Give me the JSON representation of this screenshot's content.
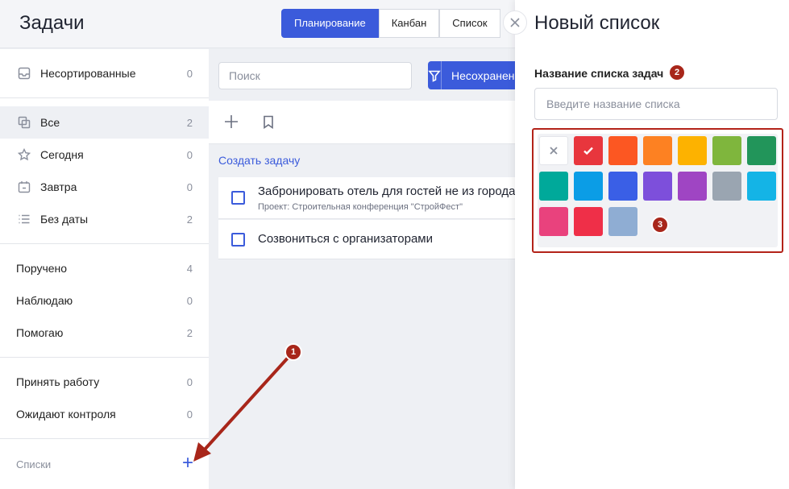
{
  "header": {
    "title": "Задачи",
    "tabs": [
      {
        "label": "Планирование",
        "active": true
      },
      {
        "label": "Канбан",
        "active": false
      },
      {
        "label": "Список",
        "active": false
      }
    ]
  },
  "sidebar": {
    "unsorted": {
      "label": "Несортированные",
      "count": "0",
      "icon": "inbox-icon"
    },
    "group1": [
      {
        "label": "Все",
        "count": "2",
        "icon": "copy-icon",
        "selected": true
      },
      {
        "label": "Сегодня",
        "count": "0",
        "icon": "star-icon"
      },
      {
        "label": "Завтра",
        "count": "0",
        "icon": "calendar-icon"
      },
      {
        "label": "Без даты",
        "count": "2",
        "icon": "list-icon"
      }
    ],
    "group2": [
      {
        "label": "Поручено",
        "count": "4"
      },
      {
        "label": "Наблюдаю",
        "count": "0"
      },
      {
        "label": "Помогаю",
        "count": "2"
      }
    ],
    "group3": [
      {
        "label": "Принять работу",
        "count": "0"
      },
      {
        "label": "Ожидают контроля",
        "count": "0"
      }
    ],
    "lists_label": "Списки",
    "lists_add": "+"
  },
  "main": {
    "search_placeholder": "Поиск",
    "filter_label": "Несохраненный фильтр",
    "create_task": "Создать задачу",
    "tasks": [
      {
        "title": "Забронировать отель для гостей не из города",
        "subtitle": "Проект: Строительная конференция \"СтройФест\""
      },
      {
        "title": "Созвониться с организаторами",
        "subtitle": ""
      }
    ]
  },
  "panel": {
    "title": "Новый список",
    "field_label": "Название списка задач",
    "input_placeholder": "Введите название списка",
    "close_icon": "close-icon",
    "colors": [
      "none",
      "#e8363d",
      "#fc5722",
      "#fd8122",
      "#fdb200",
      "#7fb63d",
      "#22955a",
      "#00a99a",
      "#0b9de6",
      "#3a5fe6",
      "#7d4fdb",
      "#9f45c3",
      "#9aa5b1",
      "#14b4e6",
      "#e9427d",
      "#ef2f48",
      "#8fadd3"
    ],
    "selected_color": "#e8363d"
  },
  "annotations": [
    "1",
    "2",
    "3"
  ],
  "accent_color": "#3b5bdb",
  "annotation_color": "#a8261a"
}
